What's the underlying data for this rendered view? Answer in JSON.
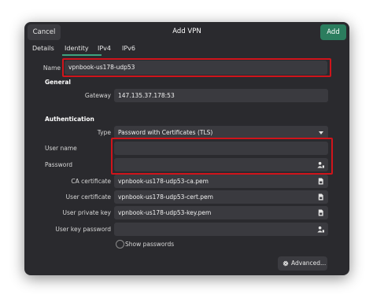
{
  "header": {
    "cancel_label": "Cancel",
    "title": "Add VPN",
    "add_label": "Add"
  },
  "tabs": [
    {
      "label": "Details"
    },
    {
      "label": "Identity"
    },
    {
      "label": "IPv4"
    },
    {
      "label": "IPv6"
    }
  ],
  "name": {
    "label": "Name",
    "value": "vpnbook-us178-udp53"
  },
  "general": {
    "heading": "General",
    "gateway_label": "Gateway",
    "gateway_value": "147.135.37.178:53"
  },
  "authentication": {
    "heading": "Authentication",
    "type_label": "Type",
    "type_value": "Password with Certificates (TLS)",
    "username_label": "User name",
    "username_value": "",
    "password_label": "Password",
    "password_value": "",
    "ca_label": "CA certificate",
    "ca_value": "vpnbook-us178-udp53-ca.pem",
    "user_cert_label": "User certificate",
    "user_cert_value": "vpnbook-us178-udp53-cert.pem",
    "user_key_label": "User private key",
    "user_key_value": "vpnbook-us178-udp53-key.pem",
    "key_password_label": "User key password",
    "key_password_value": "",
    "show_passwords_label": "Show passwords",
    "show_passwords_checked": false
  },
  "advanced_label": "Advanced...",
  "colors": {
    "accent": "#2b7d5e",
    "highlight": "#d0141b",
    "window_bg": "#2a2a2e",
    "field_bg": "#3a3a3f"
  },
  "icons": {
    "file": "file-icon",
    "password_user": "user-password-icon",
    "combo": "chevron-down-icon",
    "gear": "gear-icon"
  }
}
